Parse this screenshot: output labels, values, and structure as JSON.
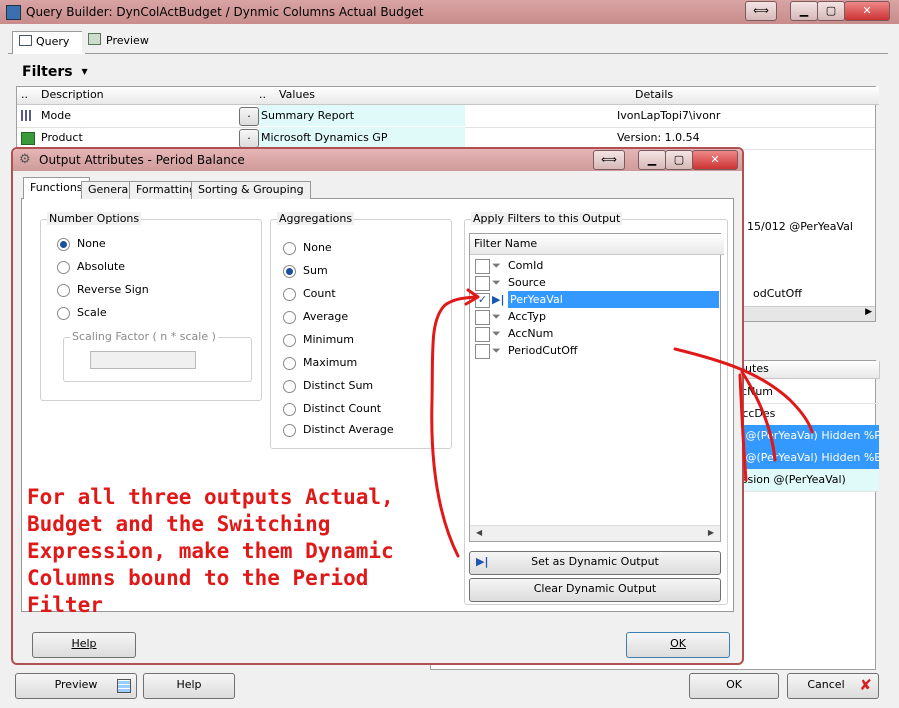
{
  "main": {
    "title": "Query Builder:  DynColActBudget / Dynmic Columns Actual Budget",
    "tabs": [
      {
        "label": "Query"
      },
      {
        "label": "Preview"
      }
    ],
    "filters_label": "Filters",
    "grid": {
      "headers": [
        "..",
        "Description",
        "..",
        "Values",
        "Details"
      ],
      "rows": [
        {
          "description": "Mode",
          "value": "Summary Report",
          "details": "IvonLapTopi7\\ivonr"
        },
        {
          "description": "Product",
          "value": "Microsoft Dynamics GP",
          "details": "Version: 1.0.54"
        }
      ],
      "partial_details": [
        "15/012 @PerYeaVal",
        "odCutOff"
      ]
    },
    "lower_grid": {
      "header_fragment": "ibutes",
      "rows": [
        "ccNum",
        "AccDes",
        "n @(PerYeaVal) Hidden %P",
        "n @(PerYeaVal) Hidden %B",
        "ession @(PerYeaVal)"
      ]
    },
    "buttons": {
      "preview": "Preview",
      "help": "Help",
      "ok": "OK",
      "cancel": "Cancel"
    }
  },
  "dialog": {
    "title": "Output Attributes - Period Balance",
    "tabs": [
      "Functions",
      "General",
      "Formatting",
      "Sorting & Grouping"
    ],
    "number_options": {
      "legend": "Number Options",
      "options": [
        "None",
        "Absolute",
        "Reverse Sign",
        "Scale"
      ],
      "selected": "None",
      "scaling_factor_label": "Scaling Factor  ( n * scale )",
      "scaling_value": ""
    },
    "aggregations": {
      "legend": "Aggregations",
      "options": [
        "None",
        "Sum",
        "Count",
        "Average",
        "Minimum",
        "Maximum",
        "Distinct Sum",
        "Distinct Count",
        "Distinct Average"
      ],
      "selected": "Sum"
    },
    "apply_filters": {
      "legend": "Apply Filters to this Output",
      "header": "Filter Name",
      "items": [
        {
          "name": "ComId",
          "checked": false
        },
        {
          "name": "Source",
          "checked": false
        },
        {
          "name": "PerYeaVal",
          "checked": true
        },
        {
          "name": "AccTyp",
          "checked": false
        },
        {
          "name": "AccNum",
          "checked": false
        },
        {
          "name": "PeriodCutOff",
          "checked": false
        }
      ],
      "set_dynamic_label": "Set as Dynamic Output",
      "clear_dynamic_label": "Clear Dynamic Output"
    },
    "buttons": {
      "help": "Help",
      "ok": "OK"
    }
  },
  "annotation": "For all three outputs Actual, Budget and the Switching Expression, make them Dynamic Columns bound to the Period Filter",
  "colors": {
    "annotation": "#e01818",
    "title_bar": "#cf9a9a",
    "selection": "#3399ff",
    "value_cell": "#e0fafa"
  }
}
